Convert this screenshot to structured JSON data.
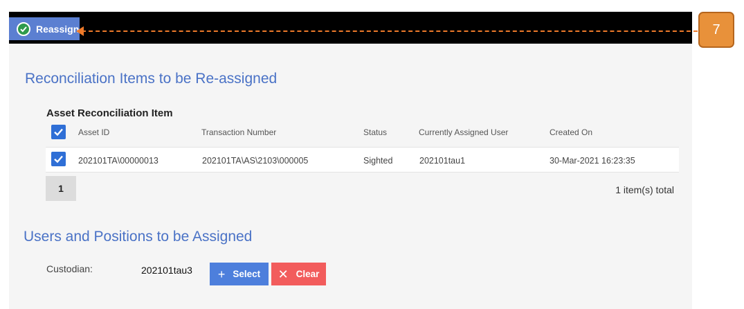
{
  "toolbar": {
    "reassign_label": "Reassign"
  },
  "callout": {
    "number": "7"
  },
  "section1": {
    "title": "Reconciliation Items to be Re-assigned",
    "table_title": "Asset Reconciliation Item",
    "columns": [
      "Asset ID",
      "Transaction Number",
      "Status",
      "Currently Assigned User",
      "Created On"
    ],
    "rows": [
      {
        "asset_id": "202101TA\\00000013",
        "transaction_number": "202101TA\\AS\\2103\\000005",
        "status": "Sighted",
        "assigned_user": "202101tau1",
        "created_on": "30-Mar-2021 16:23:35"
      }
    ],
    "pager": {
      "current_page": "1",
      "total_label": "1 item(s) total"
    }
  },
  "section2": {
    "title": "Users and Positions to be Assigned",
    "custodian_label": "Custodian:",
    "custodian_value": "202101tau3",
    "select_label": "Select",
    "clear_label": "Clear"
  },
  "colors": {
    "accent": "#4a72c6",
    "select_button": "#4d7fdc",
    "clear_button": "#f25c5c",
    "callout": "#e8913a",
    "checkbox": "#2f6fd6"
  },
  "icons": {
    "reassign": "check-circle-icon",
    "select": "plus-icon",
    "clear": "x-icon"
  }
}
